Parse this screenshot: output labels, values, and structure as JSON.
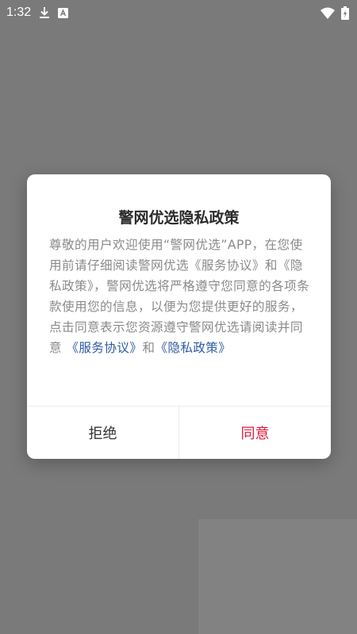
{
  "status_bar": {
    "time": "1:32",
    "icons": [
      "download-icon",
      "app-notification-icon",
      "wifi-icon",
      "battery-charging-icon"
    ]
  },
  "dialog": {
    "title": "警网优选隐私政策",
    "body_prefix": "尊敬的用户欢迎使用“警网优选”APP，在您使用前请仔细阅读警网优选《服务协议》和《隐私政策》，警网优选将严格遵守您同意的各项条款使用您的信息，以便为您提供更好的服务，点击同意表示您资源遵守警网优选请阅读并同意",
    "link_service": "《服务协议》",
    "connector": "和",
    "link_privacy": "《隐私政策》",
    "reject_label": "拒绝",
    "agree_label": "同意"
  },
  "colors": {
    "overlay": "#7a7a7a",
    "link": "#2f5aa3",
    "agree": "#e21a3c"
  }
}
